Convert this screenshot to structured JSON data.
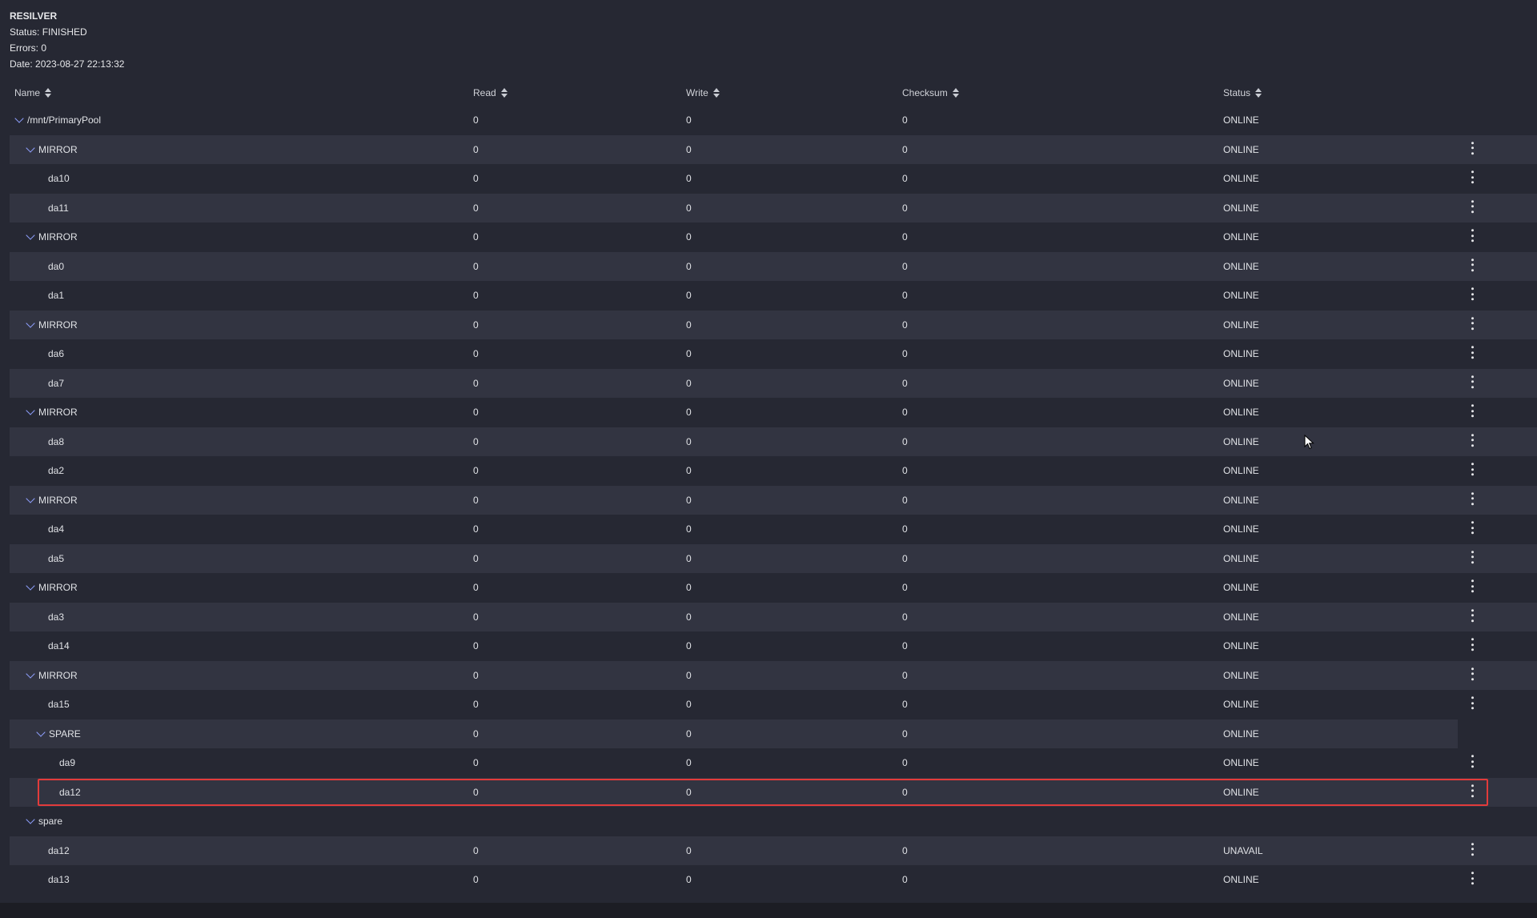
{
  "resilver": {
    "title": "RESILVER",
    "status": "Status: FINISHED",
    "errors": "Errors: 0",
    "date": "Date: 2023-08-27 22:13:32"
  },
  "columns": {
    "name": "Name",
    "read": "Read",
    "write": "Write",
    "checksum": "Checksum",
    "status": "Status"
  },
  "rows": [
    {
      "name": "/mnt/PrimaryPool",
      "read": "0",
      "write": "0",
      "checksum": "0",
      "status": "ONLINE",
      "level": 0,
      "expandable": true,
      "menu": false
    },
    {
      "name": "MIRROR",
      "read": "0",
      "write": "0",
      "checksum": "0",
      "status": "ONLINE",
      "level": 1,
      "expandable": true,
      "menu": true
    },
    {
      "name": "da10",
      "read": "0",
      "write": "0",
      "checksum": "0",
      "status": "ONLINE",
      "level": 2,
      "expandable": false,
      "menu": true
    },
    {
      "name": "da11",
      "read": "0",
      "write": "0",
      "checksum": "0",
      "status": "ONLINE",
      "level": 2,
      "expandable": false,
      "menu": true
    },
    {
      "name": "MIRROR",
      "read": "0",
      "write": "0",
      "checksum": "0",
      "status": "ONLINE",
      "level": 1,
      "expandable": true,
      "menu": true
    },
    {
      "name": "da0",
      "read": "0",
      "write": "0",
      "checksum": "0",
      "status": "ONLINE",
      "level": 2,
      "expandable": false,
      "menu": true
    },
    {
      "name": "da1",
      "read": "0",
      "write": "0",
      "checksum": "0",
      "status": "ONLINE",
      "level": 2,
      "expandable": false,
      "menu": true
    },
    {
      "name": "MIRROR",
      "read": "0",
      "write": "0",
      "checksum": "0",
      "status": "ONLINE",
      "level": 1,
      "expandable": true,
      "menu": true
    },
    {
      "name": "da6",
      "read": "0",
      "write": "0",
      "checksum": "0",
      "status": "ONLINE",
      "level": 2,
      "expandable": false,
      "menu": true
    },
    {
      "name": "da7",
      "read": "0",
      "write": "0",
      "checksum": "0",
      "status": "ONLINE",
      "level": 2,
      "expandable": false,
      "menu": true
    },
    {
      "name": "MIRROR",
      "read": "0",
      "write": "0",
      "checksum": "0",
      "status": "ONLINE",
      "level": 1,
      "expandable": true,
      "menu": true
    },
    {
      "name": "da8",
      "read": "0",
      "write": "0",
      "checksum": "0",
      "status": "ONLINE",
      "level": 2,
      "expandable": false,
      "menu": true
    },
    {
      "name": "da2",
      "read": "0",
      "write": "0",
      "checksum": "0",
      "status": "ONLINE",
      "level": 2,
      "expandable": false,
      "menu": true
    },
    {
      "name": "MIRROR",
      "read": "0",
      "write": "0",
      "checksum": "0",
      "status": "ONLINE",
      "level": 1,
      "expandable": true,
      "menu": true
    },
    {
      "name": "da4",
      "read": "0",
      "write": "0",
      "checksum": "0",
      "status": "ONLINE",
      "level": 2,
      "expandable": false,
      "menu": true
    },
    {
      "name": "da5",
      "read": "0",
      "write": "0",
      "checksum": "0",
      "status": "ONLINE",
      "level": 2,
      "expandable": false,
      "menu": true
    },
    {
      "name": "MIRROR",
      "read": "0",
      "write": "0",
      "checksum": "0",
      "status": "ONLINE",
      "level": 1,
      "expandable": true,
      "menu": true
    },
    {
      "name": "da3",
      "read": "0",
      "write": "0",
      "checksum": "0",
      "status": "ONLINE",
      "level": 2,
      "expandable": false,
      "menu": true
    },
    {
      "name": "da14",
      "read": "0",
      "write": "0",
      "checksum": "0",
      "status": "ONLINE",
      "level": 2,
      "expandable": false,
      "menu": true
    },
    {
      "name": "MIRROR",
      "read": "0",
      "write": "0",
      "checksum": "0",
      "status": "ONLINE",
      "level": 1,
      "expandable": true,
      "menu": true
    },
    {
      "name": "da15",
      "read": "0",
      "write": "0",
      "checksum": "0",
      "status": "ONLINE",
      "level": 2,
      "expandable": false,
      "menu": true
    },
    {
      "name": "SPARE",
      "read": "0",
      "write": "0",
      "checksum": "0",
      "status": "ONLINE",
      "level": 2,
      "expandable": true,
      "menu": false
    },
    {
      "name": "da9",
      "read": "0",
      "write": "0",
      "checksum": "0",
      "status": "ONLINE",
      "level": 3,
      "expandable": false,
      "menu": true
    },
    {
      "name": "da12",
      "read": "0",
      "write": "0",
      "checksum": "0",
      "status": "ONLINE",
      "level": 3,
      "expandable": false,
      "menu": true,
      "highlighted": true
    },
    {
      "name": "spare",
      "read": "",
      "write": "",
      "checksum": "",
      "status": "",
      "level": 1,
      "expandable": true,
      "menu": false
    },
    {
      "name": "da12",
      "read": "0",
      "write": "0",
      "checksum": "0",
      "status": "UNAVAIL",
      "level": 2,
      "expandable": false,
      "menu": true
    },
    {
      "name": "da13",
      "read": "0",
      "write": "0",
      "checksum": "0",
      "status": "ONLINE",
      "level": 2,
      "expandable": false,
      "menu": true
    }
  ],
  "colors": {
    "background": "#262833",
    "row_alt": "#323441",
    "highlight_border": "#e23b3b",
    "chevron": "#8fa0ff"
  }
}
